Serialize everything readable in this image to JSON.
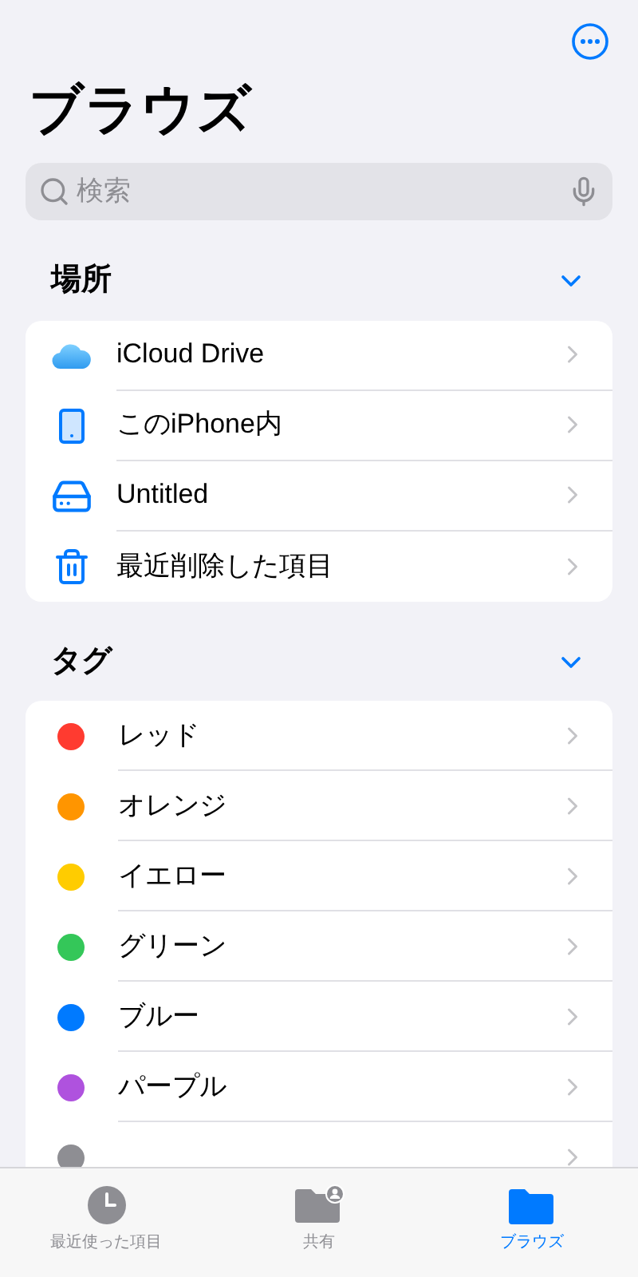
{
  "title": "ブラウズ",
  "search": {
    "placeholder": "検索"
  },
  "locations": {
    "header": "場所",
    "expanded": true,
    "items": [
      {
        "kind": "icloud",
        "name": "iCloud Drive"
      },
      {
        "kind": "phone",
        "name": "このiPhone内"
      },
      {
        "kind": "drive",
        "name": "Untitled"
      },
      {
        "kind": "trash",
        "name": "最近削除した項目"
      }
    ]
  },
  "tags": {
    "header": "タグ",
    "expanded": true,
    "items": [
      {
        "name": "レッド",
        "color": "#ff3b30"
      },
      {
        "name": "オレンジ",
        "color": "#ff9500"
      },
      {
        "name": "イエロー",
        "color": "#ffcc00"
      },
      {
        "name": "グリーン",
        "color": "#34c759"
      },
      {
        "name": "ブルー",
        "color": "#007aff"
      },
      {
        "name": "パープル",
        "color": "#af52de"
      },
      {
        "color": "#8e8e93"
      }
    ]
  },
  "tab_bar": [
    {
      "kind": "recent",
      "label": "最近使った項目",
      "selected": false
    },
    {
      "kind": "shared",
      "label": "共有",
      "selected": false
    },
    {
      "kind": "browse",
      "label": "ブラウズ",
      "selected": true
    }
  ]
}
